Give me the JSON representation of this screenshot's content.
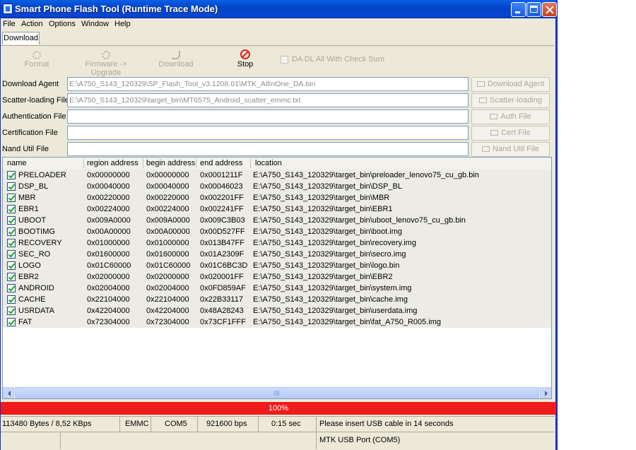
{
  "window": {
    "title": "Smart Phone Flash Tool (Runtime Trace Mode)"
  },
  "menu": [
    "File",
    "Action",
    "Options",
    "Window",
    "Help"
  ],
  "tab": {
    "label": "Download"
  },
  "toolbar": {
    "format": "Format",
    "firmware_upgrade": "Firmware -> Upgrade",
    "download": "Download",
    "stop": "Stop",
    "da_dl_checksum": "DA DL All With Check Sum"
  },
  "fields": {
    "download_agent": {
      "label": "Download Agent",
      "value": "E:\\A750_S143_120329\\SP_Flash_Tool_v3.1208.01\\MTK_AllInOne_DA.bin",
      "button": "Download Agent"
    },
    "scatter": {
      "label": "Scatter-loading File",
      "value": "E:\\A750_S143_120329\\target_bin\\MT6575_Android_scatter_emmc.txt",
      "button": "Scatter-loading"
    },
    "auth": {
      "label": "Authentication File",
      "value": "",
      "button": "Auth File"
    },
    "cert": {
      "label": "Certification File",
      "value": "",
      "button": "Cert File"
    },
    "nand": {
      "label": "Nand Util File",
      "value": "",
      "button": "Nand Util File"
    }
  },
  "table": {
    "columns": [
      "name",
      "region address",
      "begin address",
      "end address",
      "location"
    ],
    "rows": [
      {
        "name": "PRELOADER",
        "region": "0x00000000",
        "begin": "0x00000000",
        "end": "0x0001211F",
        "location": "E:\\A750_S143_120329\\target_bin\\preloader_lenovo75_cu_gb.bin"
      },
      {
        "name": "DSP_BL",
        "region": "0x00040000",
        "begin": "0x00040000",
        "end": "0x00046023",
        "location": "E:\\A750_S143_120329\\target_bin\\DSP_BL"
      },
      {
        "name": "MBR",
        "region": "0x00220000",
        "begin": "0x00220000",
        "end": "0x002201FF",
        "location": "E:\\A750_S143_120329\\target_bin\\MBR"
      },
      {
        "name": "EBR1",
        "region": "0x00224000",
        "begin": "0x00224000",
        "end": "0x002241FF",
        "location": "E:\\A750_S143_120329\\target_bin\\EBR1"
      },
      {
        "name": "UBOOT",
        "region": "0x009A0000",
        "begin": "0x009A0000",
        "end": "0x009C3B03",
        "location": "E:\\A750_S143_120329\\target_bin\\uboot_lenovo75_cu_gb.bin"
      },
      {
        "name": "BOOTIMG",
        "region": "0x00A00000",
        "begin": "0x00A00000",
        "end": "0x00D527FF",
        "location": "E:\\A750_S143_120329\\target_bin\\boot.img"
      },
      {
        "name": "RECOVERY",
        "region": "0x01000000",
        "begin": "0x01000000",
        "end": "0x013B47FF",
        "location": "E:\\A750_S143_120329\\target_bin\\recovery.img"
      },
      {
        "name": "SEC_RO",
        "region": "0x01600000",
        "begin": "0x01600000",
        "end": "0x01A2309F",
        "location": "E:\\A750_S143_120329\\target_bin\\secro.img"
      },
      {
        "name": "LOGO",
        "region": "0x01C60000",
        "begin": "0x01C60000",
        "end": "0x01C6BC3D",
        "location": "E:\\A750_S143_120329\\target_bin\\logo.bin"
      },
      {
        "name": "EBR2",
        "region": "0x02000000",
        "begin": "0x02000000",
        "end": "0x020001FF",
        "location": "E:\\A750_S143_120329\\target_bin\\EBR2"
      },
      {
        "name": "ANDROID",
        "region": "0x02004000",
        "begin": "0x02004000",
        "end": "0x0FD859AF",
        "location": "E:\\A750_S143_120329\\target_bin\\system.img"
      },
      {
        "name": "CACHE",
        "region": "0x22104000",
        "begin": "0x22104000",
        "end": "0x22B33117",
        "location": "E:\\A750_S143_120329\\target_bin\\cache.img"
      },
      {
        "name": "USRDATA",
        "region": "0x42204000",
        "begin": "0x42204000",
        "end": "0x48A28243",
        "location": "E:\\A750_S143_120329\\target_bin\\userdata.img"
      },
      {
        "name": "FAT",
        "region": "0x72304000",
        "begin": "0x72304000",
        "end": "0x73CF1FFF",
        "location": "E:\\A750_S143_120329\\target_bin\\fat_A750_R005.img"
      }
    ]
  },
  "progress": {
    "text": "100%",
    "fraction": 1.0,
    "color": "#ee1c1c"
  },
  "status": {
    "transfer": "113480 Bytes / 8,52 KBps",
    "storage": "EMMC",
    "port": "COM5",
    "baud": "921600 bps",
    "time": "0:15 sec",
    "message": "Please insert USB cable in 14 seconds",
    "usb_port": "MTK USB Port (COM5)"
  }
}
